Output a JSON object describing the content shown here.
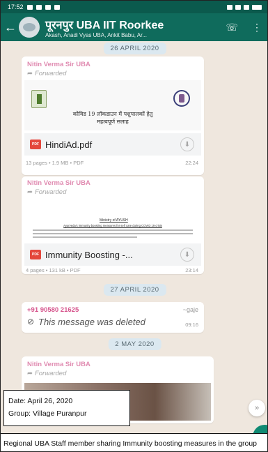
{
  "status_bar": {
    "time": "17:52"
  },
  "header": {
    "title": "पूरनपुर UBA IIT Roorkee",
    "subtitle": "Akash, Anadi Vyas UBA, Ankit Babu, Ar...",
    "back_icon": "arrow-left-icon",
    "call_icon": "call-add-icon",
    "menu_icon": "more-vert-icon"
  },
  "chat": {
    "date_separators": [
      "26 APRIL 2020",
      "27 APRIL 2020",
      "2 MAY 2020"
    ],
    "messages": [
      {
        "sender": "Nitin Verma Sir UBA",
        "forwarded": "Forwarded",
        "preview_text_line1": "कोविड 19 लॉकडाउन में पशुपालकों हेतु",
        "preview_text_line2": "महत्वपूर्ण सलाह",
        "pdf_label": "PDF",
        "doc_name": "HindiAd.pdf",
        "meta": "13 pages • 1.9 MB • PDF",
        "time": "22:24"
      },
      {
        "sender": "Nitin Verma Sir UBA",
        "forwarded": "Forwarded",
        "preview_title": "Ministry of AYUSH",
        "preview_subtitle": "Ayurveda's immunity boosting measures for self care during COVID 19 crisis",
        "pdf_label": "PDF",
        "doc_name": "Immunity Boosting -...",
        "meta": "4 pages • 131 kB • PDF",
        "time": "23:14"
      },
      {
        "sender": "+91 90580 21625",
        "tag": "~gaje",
        "text": "This message was deleted",
        "time": "09:16"
      },
      {
        "sender": "Nitin Verma Sir UBA",
        "forwarded": "Forwarded"
      }
    ]
  },
  "annotation": {
    "date_line": "Date: April 26, 2020",
    "group_line": "Group: Village Puranpur",
    "caption": "Regional UBA Staff member sharing Immunity boosting measures in the group"
  },
  "colors": {
    "header": "#0f6b5c",
    "status_bar": "#0b5a4d",
    "chat_bg": "#efe7de",
    "sender": "#e08ab0",
    "pdf_badge": "#e4473c"
  }
}
